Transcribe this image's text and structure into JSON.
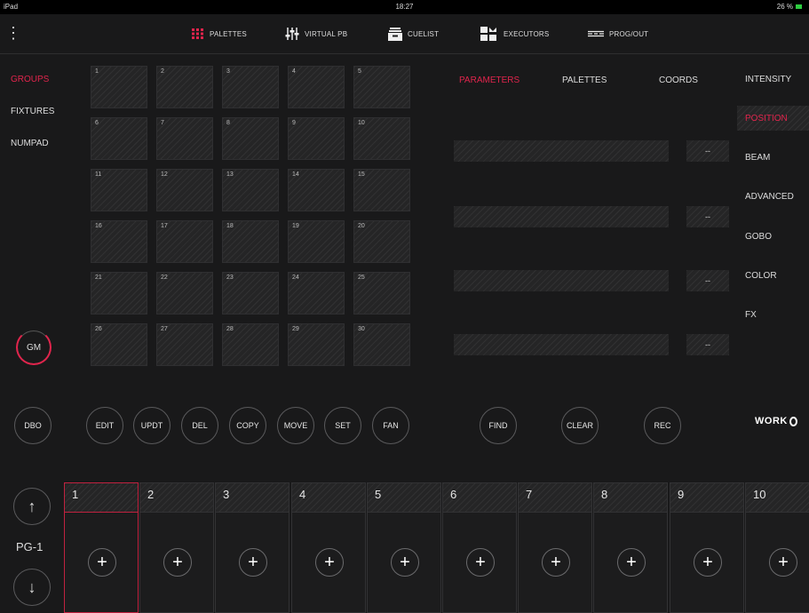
{
  "status_bar": {
    "left": "iPad",
    "time": "18:27",
    "battery": "26 %"
  },
  "nav": [
    {
      "label": "PALETTES",
      "icon": "palettes-grid-icon"
    },
    {
      "label": "VIRTUAL PB",
      "icon": "faders-icon"
    },
    {
      "label": "CUELIST",
      "icon": "cuelist-icon"
    },
    {
      "label": "EXECUTORS",
      "icon": "executors-icon"
    },
    {
      "label": "PROG/OUT",
      "icon": "prog-out-icon"
    }
  ],
  "left_menu": [
    "GROUPS",
    "FIXTURES",
    "NUMPAD"
  ],
  "gm_label": "GM",
  "groups": [
    "1",
    "2",
    "3",
    "4",
    "5",
    "6",
    "7",
    "8",
    "9",
    "10",
    "11",
    "12",
    "13",
    "14",
    "15",
    "16",
    "17",
    "18",
    "19",
    "20",
    "21",
    "22",
    "23",
    "24",
    "25",
    "26",
    "27",
    "28",
    "29",
    "30"
  ],
  "parameter_tabs": [
    "PARAMETERS",
    "PALETTES",
    "COORDS"
  ],
  "parameter_values": [
    "--",
    "--",
    "--",
    "--"
  ],
  "attributes": [
    "INTENSITY",
    "POSITION",
    "BEAM",
    "ADVANCED",
    "GOBO",
    "COLOR",
    "FX"
  ],
  "action_buttons": [
    "DBO",
    "EDIT",
    "UPDT",
    "DEL",
    "COPY",
    "MOVE",
    "SET",
    "FAN",
    "FIND",
    "CLEAR",
    "REC"
  ],
  "logo": "WORK",
  "page": {
    "label": "PG-1",
    "up_icon": "arrow-up-icon",
    "down_icon": "arrow-down-icon"
  },
  "executors": [
    "1",
    "2",
    "3",
    "4",
    "5",
    "6",
    "7",
    "8",
    "9",
    "10"
  ],
  "colors": {
    "accent": "#e0244c",
    "background": "#19191a",
    "cell": "#252526"
  }
}
